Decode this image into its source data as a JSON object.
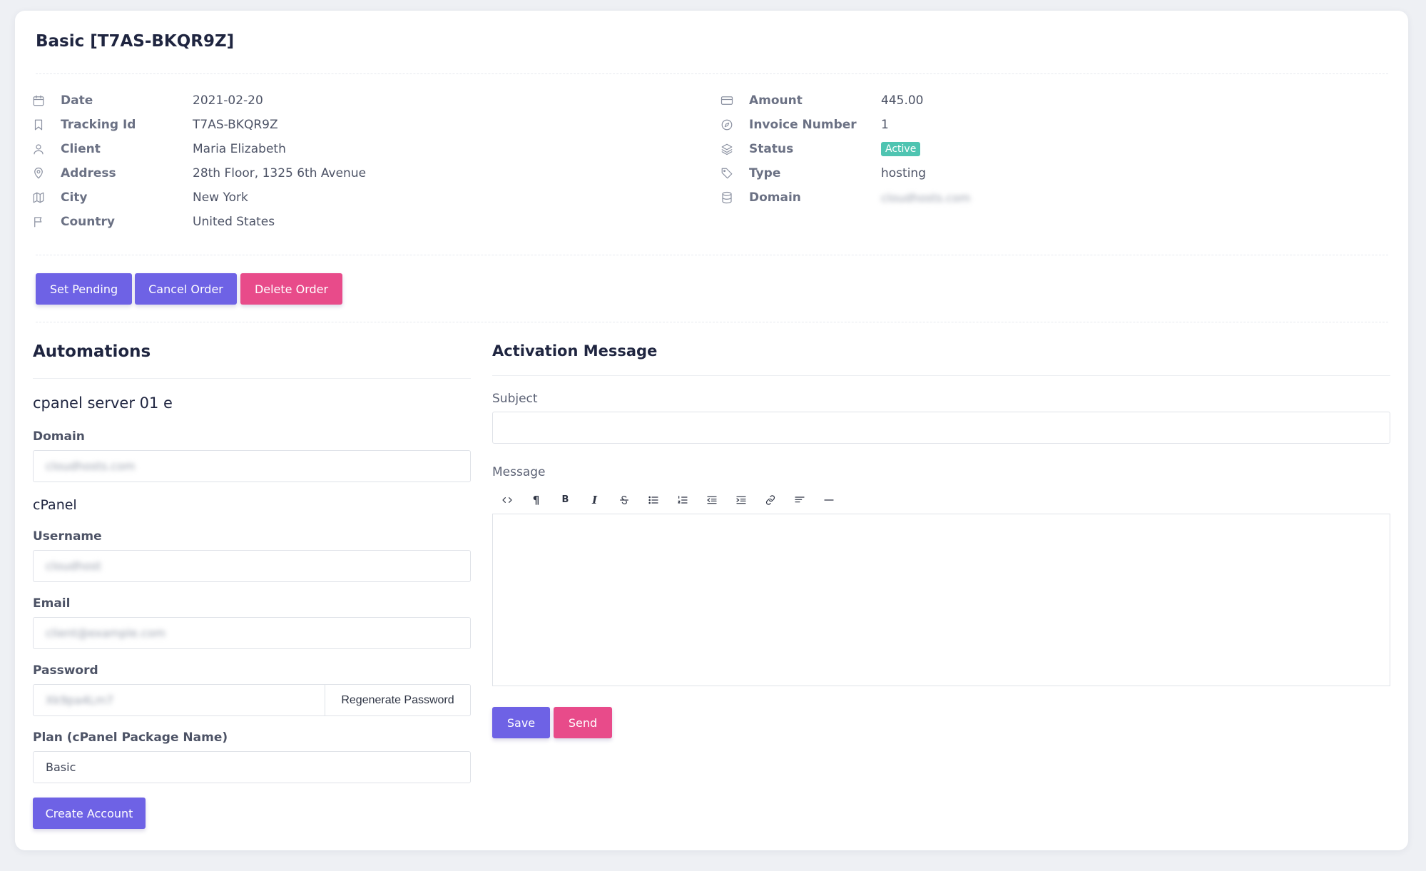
{
  "page": {
    "title": "Basic [T7AS-BKQR9Z]"
  },
  "details_left": [
    {
      "icon": "calendar-icon",
      "label": "Date",
      "value": "2021-02-20"
    },
    {
      "icon": "bookmark-icon",
      "label": "Tracking Id",
      "value": "T7AS-BKQR9Z"
    },
    {
      "icon": "user-icon",
      "label": "Client",
      "value": "Maria Elizabeth"
    },
    {
      "icon": "map-pin-icon",
      "label": "Address",
      "value": "28th Floor, 1325 6th Avenue"
    },
    {
      "icon": "map-icon",
      "label": "City",
      "value": "New York"
    },
    {
      "icon": "flag-icon",
      "label": "Country",
      "value": "United States"
    }
  ],
  "details_right": [
    {
      "icon": "credit-card-icon",
      "label": "Amount",
      "value": "445.00"
    },
    {
      "icon": "compass-icon",
      "label": "Invoice Number",
      "value": "1"
    },
    {
      "icon": "layers-icon",
      "label": "Status",
      "value": "Active"
    },
    {
      "icon": "tag-icon",
      "label": "Type",
      "value": "hosting"
    },
    {
      "icon": "database-icon",
      "label": "Domain",
      "value": "cloudhosts.com"
    }
  ],
  "actions": {
    "set_pending": "Set Pending",
    "cancel_order": "Cancel Order",
    "delete_order": "Delete Order"
  },
  "automations": {
    "title": "Automations",
    "server_name": "cpanel server 01 e",
    "domain_label": "Domain",
    "domain_value": "cloudhosts.com",
    "cpanel_title": "cPanel",
    "username_label": "Username",
    "username_value": "cloudhost",
    "email_label": "Email",
    "email_value": "client@example.com",
    "password_label": "Password",
    "password_value": "Xk9pa4Lm7",
    "regenerate_label": "Regenerate Password",
    "plan_label": "Plan (cPanel Package Name)",
    "plan_value": "Basic",
    "create_account": "Create Account"
  },
  "activation": {
    "title": "Activation Message",
    "subject_label": "Subject",
    "subject_value": "",
    "message_label": "Message",
    "toolbar": [
      "code-view-icon",
      "paragraph-icon",
      "bold-icon",
      "italic-icon",
      "strikethrough-icon",
      "bullet-list-icon",
      "numbered-list-icon",
      "outdent-icon",
      "indent-icon",
      "link-icon",
      "align-left-icon",
      "horizontal-rule-icon"
    ],
    "save": "Save",
    "send": "Send"
  },
  "colors": {
    "primary": "#6e62e5",
    "danger": "#e84b8a",
    "status_active": "#4fc4b1"
  }
}
